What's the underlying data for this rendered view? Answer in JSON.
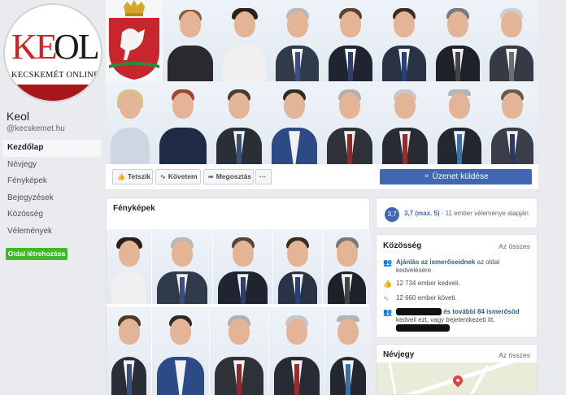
{
  "logo": {
    "text_red": "KE",
    "text_dark": "OL",
    "subtitle": "KECSKEMÉT ONLINE"
  },
  "page": {
    "name": "Keol",
    "handle": "@kecskemet.hu"
  },
  "nav": {
    "items": [
      {
        "label": "Kezdőlap",
        "active": true
      },
      {
        "label": "Névjegy"
      },
      {
        "label": "Fényképek"
      },
      {
        "label": "Bejegyzések"
      },
      {
        "label": "Közösség"
      },
      {
        "label": "Vélemények"
      }
    ],
    "create_page": "Oldal létrehozása"
  },
  "actions": {
    "like": "Tetszik",
    "follow": "Követem",
    "share": "Megosztás",
    "more": "···",
    "message": "Üzenet küldése"
  },
  "photos": {
    "title": "Fényképek"
  },
  "rating": {
    "score": "3,7",
    "text": "3,7 (max. 5)",
    "suffix": " · 11 ember véleménye alapján"
  },
  "community": {
    "title": "Közösség",
    "see_all": "Az összes",
    "invite_link": "Ajánlás az ismerőseidnek",
    "invite_text": " az oldal kedvelésére",
    "likes": "12 734 ember kedveli.",
    "follows": "12 660 ember követi.",
    "friends_link": "és további 84 ismerősöd",
    "friends_text": "kedveli ezt, vagy bejelentkezett itt."
  },
  "about": {
    "title": "Névjegy",
    "see_all": "Az összes"
  },
  "colors": {
    "accent": "#4267b2",
    "green": "#42b72a",
    "logo_red": "#d6201f"
  }
}
